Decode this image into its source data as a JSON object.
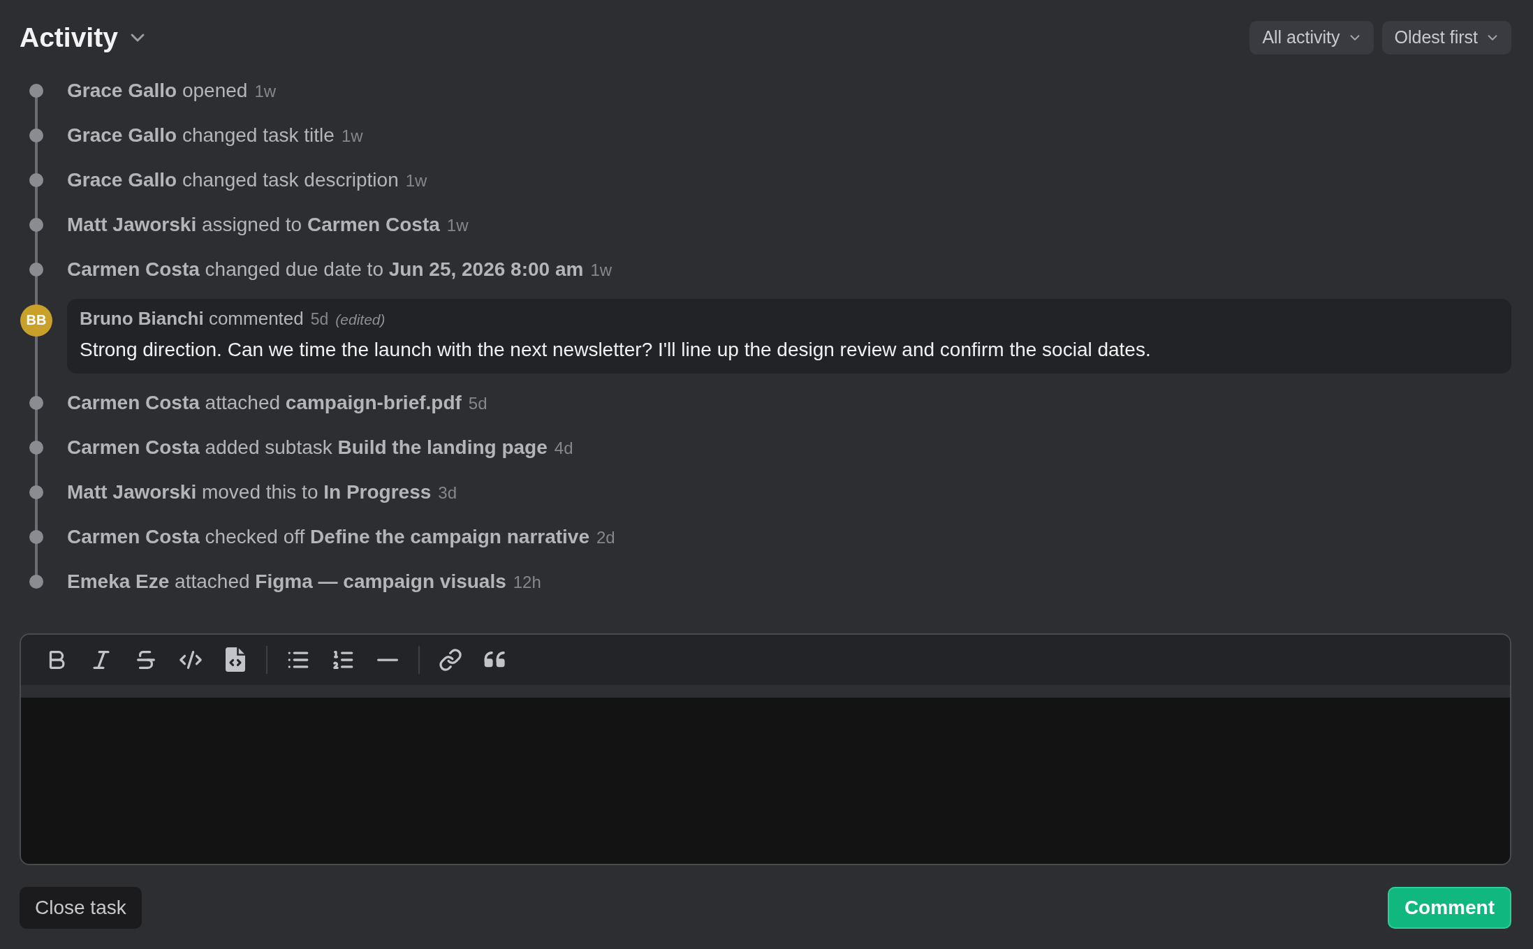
{
  "header": {
    "title": "Activity",
    "filters": [
      {
        "label": "All activity"
      },
      {
        "label": "Oldest first"
      }
    ]
  },
  "activity": [
    {
      "kind": "event",
      "text": "**Grace Gallo** opened",
      "time": "1w"
    },
    {
      "kind": "event",
      "text": "**Grace Gallo** changed task title",
      "time": "1w"
    },
    {
      "kind": "event",
      "text": "**Grace Gallo** changed task description",
      "time": "1w"
    },
    {
      "kind": "event",
      "text": "**Matt Jaworski** assigned to **Carmen Costa**",
      "time": "1w"
    },
    {
      "kind": "event",
      "text": "**Carmen Costa** changed due date to **Jun 25, 2026 8:00 am**",
      "time": "1w"
    },
    {
      "kind": "comment",
      "initials": "BB",
      "text": "**Bruno Bianchi** commented",
      "time": "5d",
      "note": "(edited)",
      "body": "Strong direction. Can we time the launch with the next newsletter? I'll line up the design review and confirm the social dates."
    },
    {
      "kind": "event",
      "text": "**Carmen Costa** attached **campaign-brief.pdf**",
      "time": "5d"
    },
    {
      "kind": "event",
      "text": "**Carmen Costa** added subtask **Build the landing page**",
      "time": "4d"
    },
    {
      "kind": "event",
      "text": "**Matt Jaworski** moved this to **In Progress**",
      "time": "3d"
    },
    {
      "kind": "event",
      "text": "**Carmen Costa** checked off **Define the campaign narrative**",
      "time": "2d"
    },
    {
      "kind": "event",
      "text": "**Emeka Eze** attached **Figma — campaign visuals**",
      "time": "12h"
    }
  ],
  "actions": [
    {
      "label": "Close task",
      "kind": "secondary"
    },
    {
      "label": "Comment",
      "kind": "primary"
    }
  ]
}
